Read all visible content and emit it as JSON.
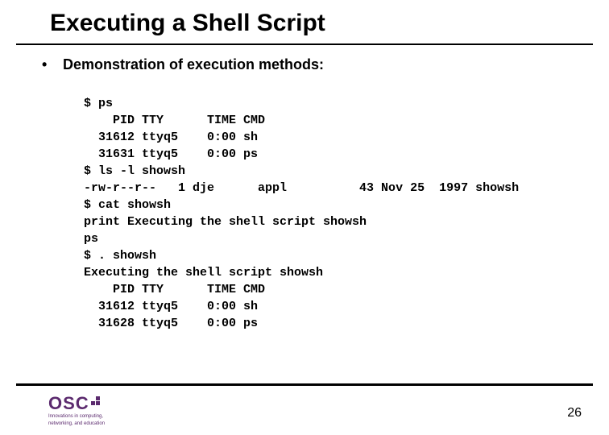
{
  "title": "Executing a Shell Script",
  "bullet": "Demonstration of execution methods:",
  "code": "$ ps\n    PID TTY      TIME CMD\n  31612 ttyq5    0:00 sh\n  31631 ttyq5    0:00 ps\n$ ls -l showsh\n-rw-r--r--   1 dje      appl          43 Nov 25  1997 showsh\n$ cat showsh\nprint Executing the shell script showsh\nps\n$ . showsh\nExecuting the shell script showsh\n    PID TTY      TIME CMD\n  31612 ttyq5    0:00 sh\n  31628 ttyq5    0:00 ps",
  "page_number": "26",
  "logo": {
    "text": "OSC",
    "tagline1": "Innovations in computing,",
    "tagline2": "networking, and education"
  }
}
